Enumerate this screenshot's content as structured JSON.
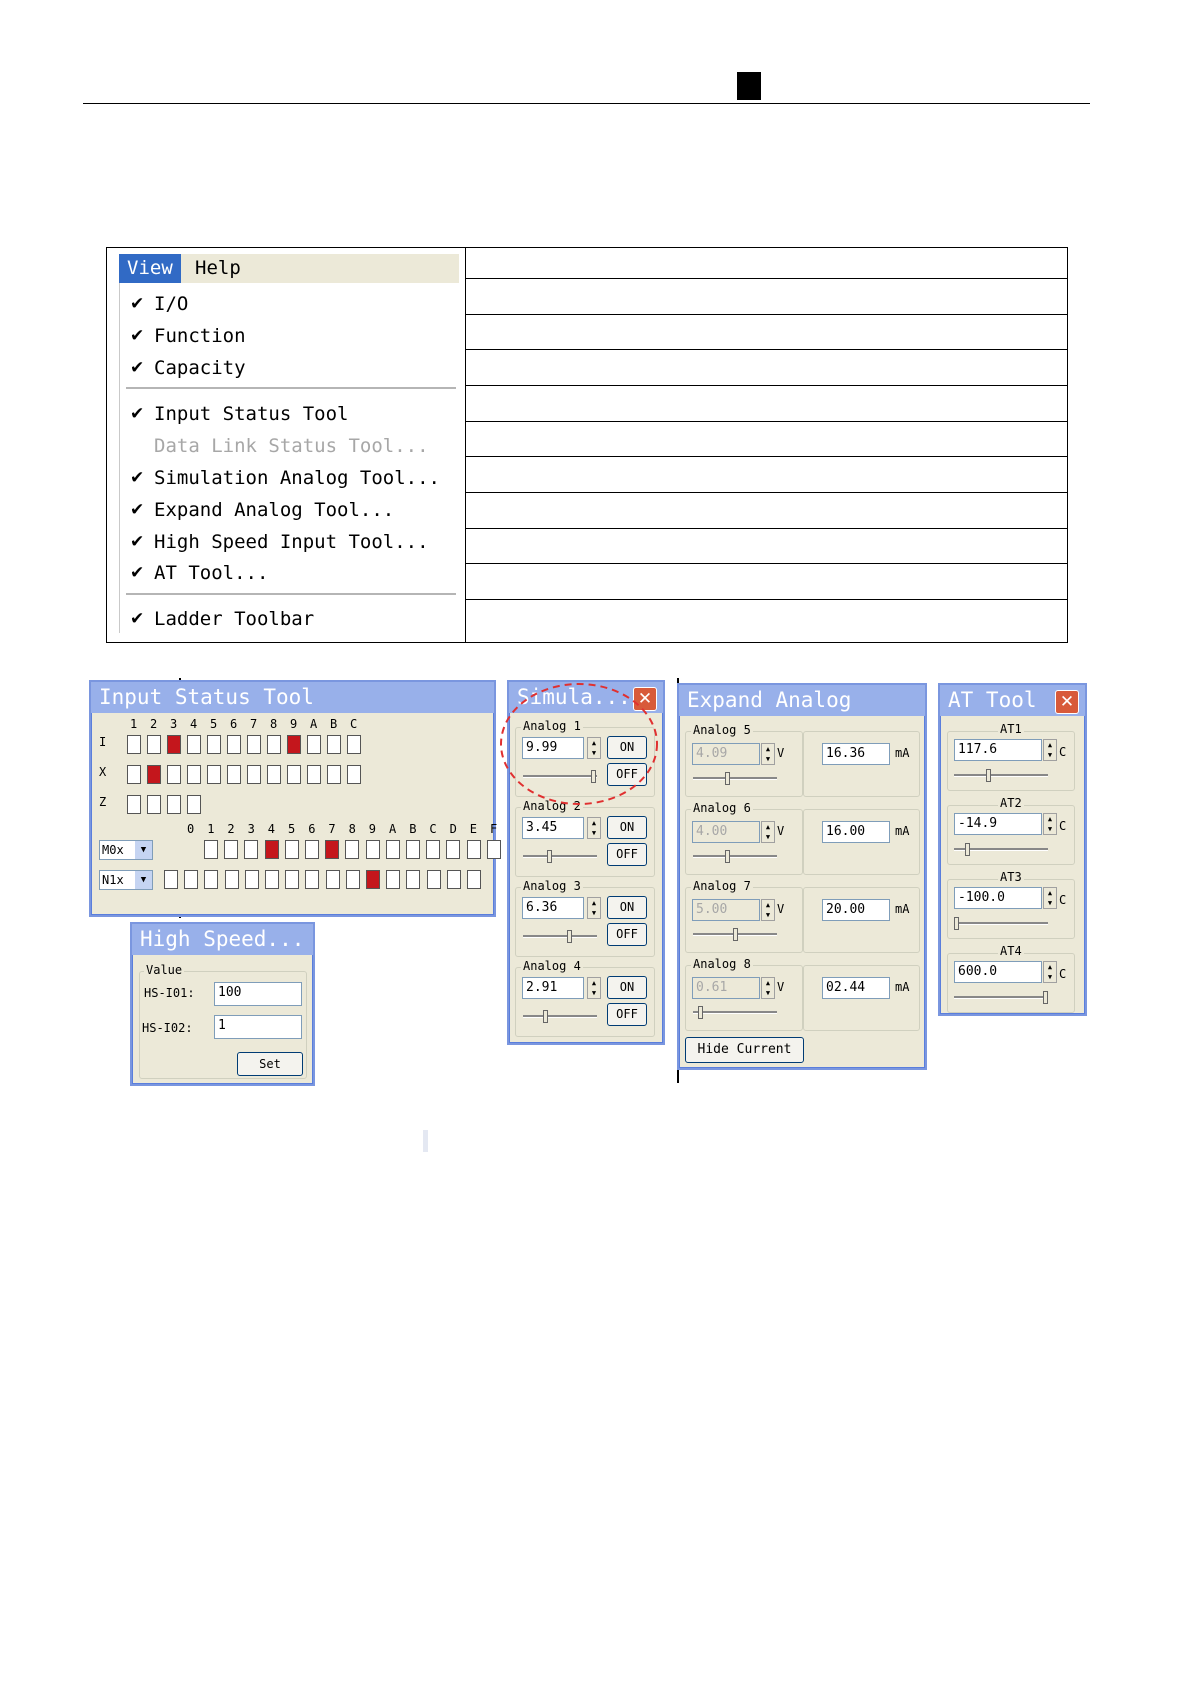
{
  "menu": {
    "tabs": [
      {
        "label": "View"
      },
      {
        "label": "Help"
      }
    ],
    "items": [
      {
        "label": "I/O",
        "checked": true,
        "disabled": false
      },
      {
        "label": "Function",
        "checked": true,
        "disabled": false
      },
      {
        "label": "Capacity",
        "checked": true,
        "disabled": false
      },
      {
        "label": "Input Status Tool",
        "checked": true,
        "disabled": false
      },
      {
        "label": "Data Link Status Tool...",
        "checked": false,
        "disabled": true
      },
      {
        "label": "Simulation Analog Tool...",
        "checked": true,
        "disabled": false
      },
      {
        "label": "Expand Analog Tool...",
        "checked": true,
        "disabled": false
      },
      {
        "label": "High Speed Input Tool...",
        "checked": true,
        "disabled": false
      },
      {
        "label": "AT Tool...",
        "checked": true,
        "disabled": false
      },
      {
        "label": "Ladder Toolbar",
        "checked": true,
        "disabled": false
      }
    ],
    "check_glyph": "✔"
  },
  "input_status": {
    "title": "Input Status Tool",
    "row_labels": [
      "I",
      "X",
      "Z"
    ],
    "top_cols": [
      "1",
      "2",
      "3",
      "4",
      "5",
      "6",
      "7",
      "8",
      "9",
      "A",
      "B",
      "C"
    ],
    "bottom_cols": [
      "0",
      "1",
      "2",
      "3",
      "4",
      "5",
      "6",
      "7",
      "8",
      "9",
      "A",
      "B",
      "C",
      "D",
      "E",
      "F"
    ],
    "dropdowns": [
      "M0x",
      "N1x"
    ],
    "dropdown_arrow": "▼",
    "i_on": [
      2,
      8
    ],
    "x_on": [
      1
    ],
    "m_on": [
      3,
      6
    ],
    "n_on": [
      10
    ],
    "accent_on": "#c4161c"
  },
  "high_speed": {
    "title": "High Speed...",
    "group": "Value",
    "fields": [
      {
        "label": "HS-I01:",
        "value": "100"
      },
      {
        "label": "HS-I02:",
        "value": "1"
      }
    ],
    "set_label": "Set"
  },
  "simulation": {
    "title": "Simula...",
    "close_glyph": "✕",
    "on_label": "ON",
    "off_label": "OFF",
    "channels": [
      {
        "name": "Analog 1",
        "value": "9.99",
        "level": 0.99
      },
      {
        "name": "Analog 2",
        "value": "3.45",
        "level": 0.35
      },
      {
        "name": "Analog 3",
        "value": "6.36",
        "level": 0.64
      },
      {
        "name": "Analog 4",
        "value": "2.91",
        "level": 0.29
      }
    ]
  },
  "expand_analog": {
    "title": "Expand Analog",
    "volt_unit": "V",
    "current_unit": "mA",
    "channels": [
      {
        "name": "Analog 5",
        "volts": "4.09",
        "current": "16.36",
        "level": 0.41
      },
      {
        "name": "Analog 6",
        "volts": "4.00",
        "current": "16.00",
        "level": 0.4
      },
      {
        "name": "Analog 7",
        "volts": "5.00",
        "current": "20.00",
        "level": 0.5
      },
      {
        "name": "Analog 8",
        "volts": "0.61",
        "current": "02.44",
        "level": 0.06
      }
    ],
    "hide_label": "Hide Current"
  },
  "at_tool": {
    "title": "AT Tool",
    "close_glyph": "✕",
    "unit": "C",
    "channels": [
      {
        "name": "AT1",
        "value": "117.6",
        "level": 0.36
      },
      {
        "name": "AT2",
        "value": "-14.9",
        "level": 0.12
      },
      {
        "name": "AT3",
        "value": "-100.0",
        "level": 0.0
      },
      {
        "name": "AT4",
        "value": "600.0",
        "level": 1.0
      }
    ]
  },
  "spin_glyphs": {
    "up": "▲",
    "down": "▼"
  },
  "colors": {
    "titlebar": "#98b0ea",
    "window_bg": "#ece9d8",
    "highlight_circle": "#e03030",
    "menu_active": "#316ac5"
  }
}
